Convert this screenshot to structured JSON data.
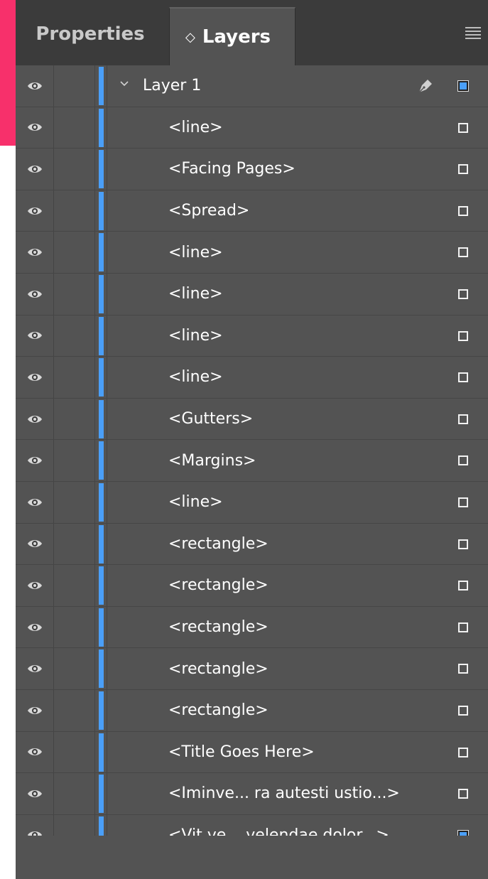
{
  "tabs": {
    "properties": "Properties",
    "layers": "Layers",
    "layers_sort_glyph": "◇"
  },
  "colors": {
    "layer_color": "#4a9ff8",
    "panel_bg": "#535353",
    "tabbar_bg": "#3b3b3b",
    "accent_strip": "#f7306b"
  },
  "layer": {
    "name": "Layer 1",
    "expanded": true,
    "selected_indicator": "filled"
  },
  "items": [
    {
      "name": "<line>",
      "selected": false
    },
    {
      "name": "<Facing Pages>",
      "selected": false
    },
    {
      "name": "<Spread>",
      "selected": false
    },
    {
      "name": "<line>",
      "selected": false
    },
    {
      "name": "<line>",
      "selected": false
    },
    {
      "name": "<line>",
      "selected": false
    },
    {
      "name": "<line>",
      "selected": false
    },
    {
      "name": "<Gutters>",
      "selected": false
    },
    {
      "name": "<Margins>",
      "selected": false
    },
    {
      "name": "<line>",
      "selected": false
    },
    {
      "name": "<rectangle>",
      "selected": false
    },
    {
      "name": "<rectangle>",
      "selected": false
    },
    {
      "name": "<rectangle>",
      "selected": false
    },
    {
      "name": "<rectangle>",
      "selected": false
    },
    {
      "name": "<rectangle>",
      "selected": false
    },
    {
      "name": "<Title Goes Here>",
      "selected": false
    },
    {
      "name": "<Iminve... ra autesti ustio...>",
      "selected": false
    },
    {
      "name": "<Vit ve... velendae dolor...>",
      "selected": true
    }
  ],
  "icons": {
    "visibility": "eye-icon",
    "expand": "chevron-down-icon",
    "target": "pen-icon",
    "menu": "hamburger-menu-icon"
  }
}
